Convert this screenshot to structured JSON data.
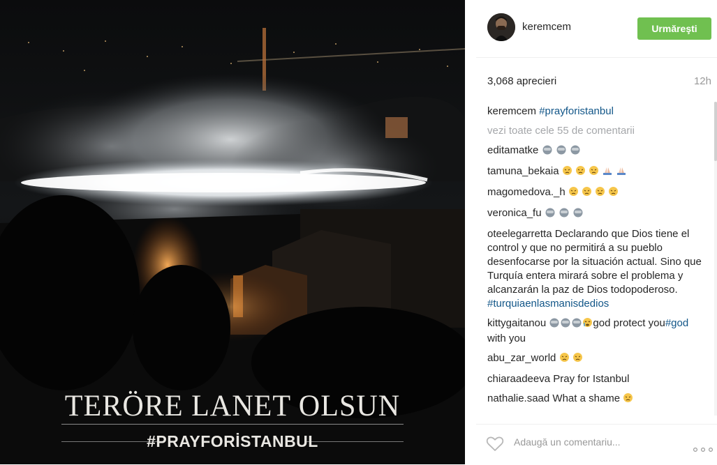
{
  "post": {
    "overlay_title": "TERÖRE LANET OLSUN",
    "overlay_hashtag": "#PRAYFORİSTANBUL"
  },
  "header": {
    "username": "keremcem",
    "follow_label": "Urmăreşti"
  },
  "stats": {
    "likes": "3,068 aprecieri",
    "time": "12h"
  },
  "caption": {
    "user": "keremcem",
    "text": "#prayforistanbul"
  },
  "view_all": "vezi toate cele 55 de comentarii",
  "comments": [
    {
      "user": "editamatke",
      "text": ""
    },
    {
      "user": "tamuna_bekaia",
      "text": ""
    },
    {
      "user": "magomedova._h",
      "text": ""
    },
    {
      "user": "veronica_fu",
      "text": ""
    },
    {
      "user": "oteelegarretta",
      "text": "Declarando que Dios tiene el control y que no permitirá a su pueblo desenfocarse por la situación actual. Sino que Turquía entera mirará sobre el problema y alcanzarán la paz de Dios todopoderoso.",
      "hashtag": "#turquiaenlasmanisdedios"
    },
    {
      "user": "kittygaitanou",
      "text": "god protect you",
      "hashtag": "#god",
      "text2": " with you"
    },
    {
      "user": "abu_zar_world",
      "text": ""
    },
    {
      "user": "chiaraadeeva",
      "text": "Pray for Istanbul"
    },
    {
      "user": "nathalie.saad",
      "text": "What a shame"
    }
  ],
  "footer": {
    "comment_placeholder": "Adaugă un comentariu..."
  },
  "icons": {
    "heart": "heart-icon",
    "more": "more-options-icon",
    "emoji_monkey": "see-no-evil-monkey-emoji",
    "emoji_sad": "pensive-face-emoji",
    "emoji_pray": "folded-hands-emoji",
    "emoji_cry": "crying-face-emoji"
  },
  "colors": {
    "follow_button": "#70c050",
    "hashtag": "#125688",
    "muted": "#999999"
  }
}
